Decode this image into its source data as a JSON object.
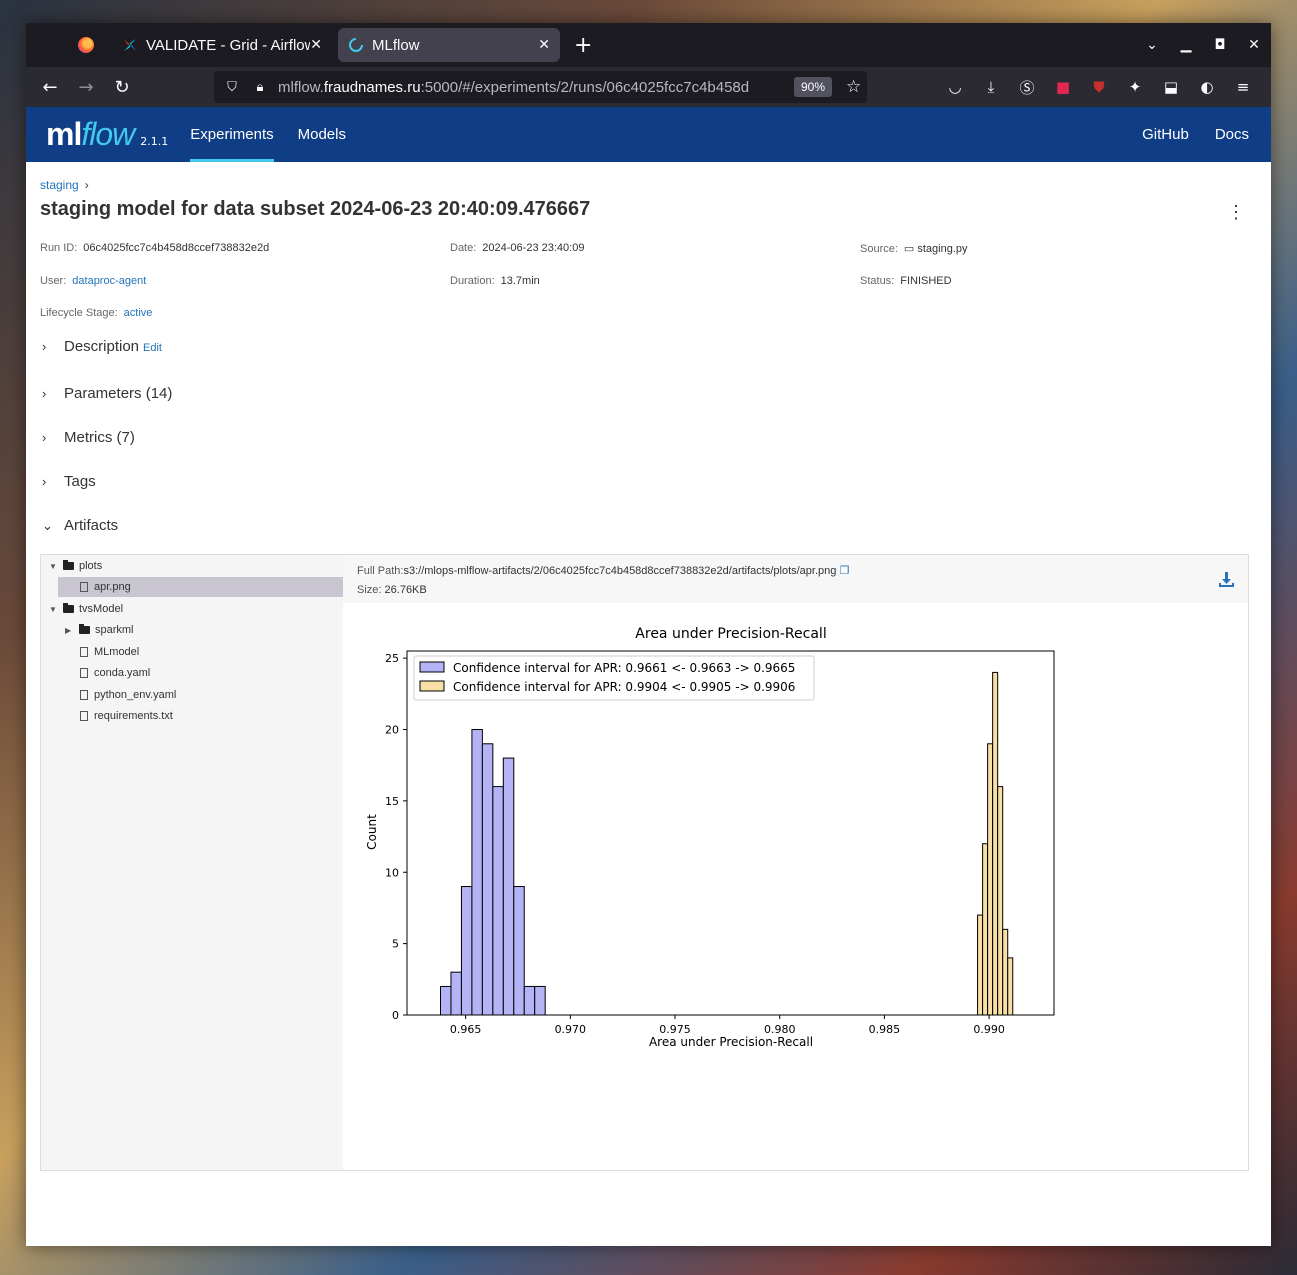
{
  "browser": {
    "tabs": [
      {
        "label": "VALIDATE - Grid - Airflow",
        "close": "✕"
      },
      {
        "label": "MLflow",
        "close": "✕"
      }
    ],
    "new_tab": "+",
    "url_host_prefix": "mlflow.",
    "url_host": "fraudnames.ru",
    "url_path": ":5000/#/experiments/2/runs/06c4025fcc7c4b458d",
    "zoom": "90%"
  },
  "header": {
    "logo_ml": "ml",
    "logo_flow": "flow",
    "version": "2.1.1",
    "nav": [
      "Experiments",
      "Models"
    ],
    "right": [
      "GitHub",
      "Docs"
    ]
  },
  "breadcrumb": {
    "label": "staging",
    "sep": "›"
  },
  "run": {
    "title": "staging model for data subset 2024-06-23 20:40:09.476667",
    "run_id_key": "Run ID:",
    "run_id": "06c4025fcc7c4b458d8ccef738832e2d",
    "date_key": "Date:",
    "date": "2024-06-23 23:40:09",
    "source_key": "Source:",
    "source": "staging.py",
    "user_key": "User:",
    "user": "dataproc-agent",
    "duration_key": "Duration:",
    "duration": "13.7min",
    "status_key": "Status:",
    "status": "FINISHED",
    "lifecycle_key": "Lifecycle Stage:",
    "lifecycle": "active"
  },
  "sections": {
    "description": "Description",
    "edit": "Edit",
    "parameters": "Parameters (14)",
    "metrics": "Metrics (7)",
    "tags": "Tags",
    "artifacts": "Artifacts"
  },
  "tree": {
    "plots": "plots",
    "apr": "apr.png",
    "tvs": "tvsModel",
    "sparkml": "sparkml",
    "mlmodel": "MLmodel",
    "conda": "conda.yaml",
    "python_env": "python_env.yaml",
    "requirements": "requirements.txt"
  },
  "artifact": {
    "path_key": "Full Path:",
    "path": "s3://mlops-mlflow-artifacts/2/06c4025fcc7c4b458d8ccef738832e2d/artifacts/plots/apr.png",
    "size_key": "Size:",
    "size": "26.76KB"
  },
  "chart_data": {
    "type": "bar",
    "title": "Area under Precision-Recall",
    "xlabel": "Area under Precision-Recall",
    "ylabel": "Count",
    "xlim": [
      0.9622,
      0.9931
    ],
    "ylim": [
      0,
      25.5
    ],
    "xticks": [
      "0.965",
      "0.970",
      "0.975",
      "0.980",
      "0.985",
      "0.990"
    ],
    "xtick_values": [
      0.965,
      0.97,
      0.975,
      0.98,
      0.985,
      0.99
    ],
    "yticks": [
      "0",
      "5",
      "10",
      "15",
      "20",
      "25"
    ],
    "ytick_values": [
      0,
      5,
      10,
      15,
      20,
      25
    ],
    "legend_position": "top-left",
    "series": [
      {
        "name": "Confidence interval for APR: 0.9661 <- 0.9663 -> 0.9665",
        "color": "#b3b3f5",
        "bin_start": 0.9638,
        "bin_width": 0.0005,
        "values": [
          2,
          3,
          9,
          20,
          19,
          16,
          18,
          9,
          2,
          2
        ]
      },
      {
        "name": "Confidence interval for APR: 0.9904 <- 0.9905 -> 0.9906",
        "color": "#f7dfa5",
        "bin_start": 0.98945,
        "bin_width": 0.00024,
        "values": [
          7,
          12,
          19,
          24,
          16,
          6,
          4
        ]
      }
    ]
  }
}
